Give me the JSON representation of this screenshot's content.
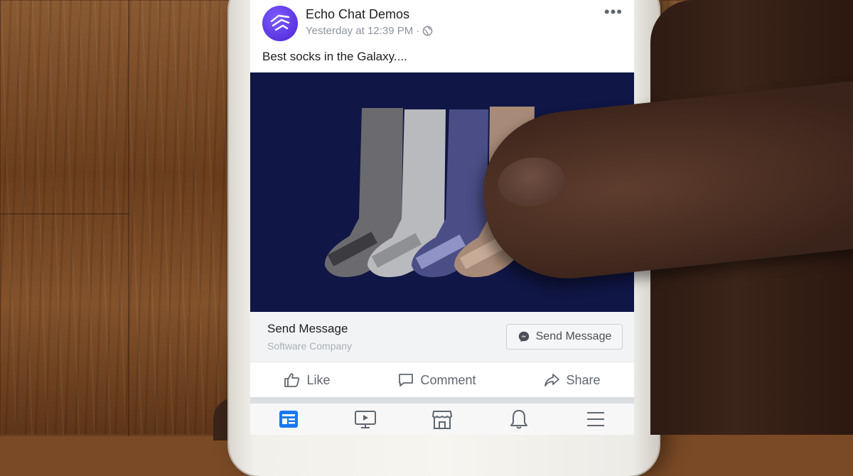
{
  "post": {
    "page_name": "Echo Chat Demos",
    "timestamp": "Yesterday at 12:39 PM ·",
    "text": "Best socks in the Galaxy....",
    "more_icon": "more-horizontal-icon",
    "privacy_icon": "globe-icon"
  },
  "cta": {
    "title": "Send Message",
    "subtitle": "Software Company",
    "button_label": "Send Message",
    "button_icon": "messenger-icon"
  },
  "actions": {
    "like": "Like",
    "comment": "Comment",
    "share": "Share"
  },
  "tabs": [
    {
      "icon": "news-feed-icon",
      "active": true
    },
    {
      "icon": "watch-video-icon",
      "active": false
    },
    {
      "icon": "marketplace-icon",
      "active": false
    },
    {
      "icon": "notifications-bell-icon",
      "active": false
    },
    {
      "icon": "menu-icon",
      "active": false
    }
  ],
  "colors": {
    "brand": "#5b34e0",
    "image_background": "#101645",
    "active_tab": "#1877f2"
  }
}
